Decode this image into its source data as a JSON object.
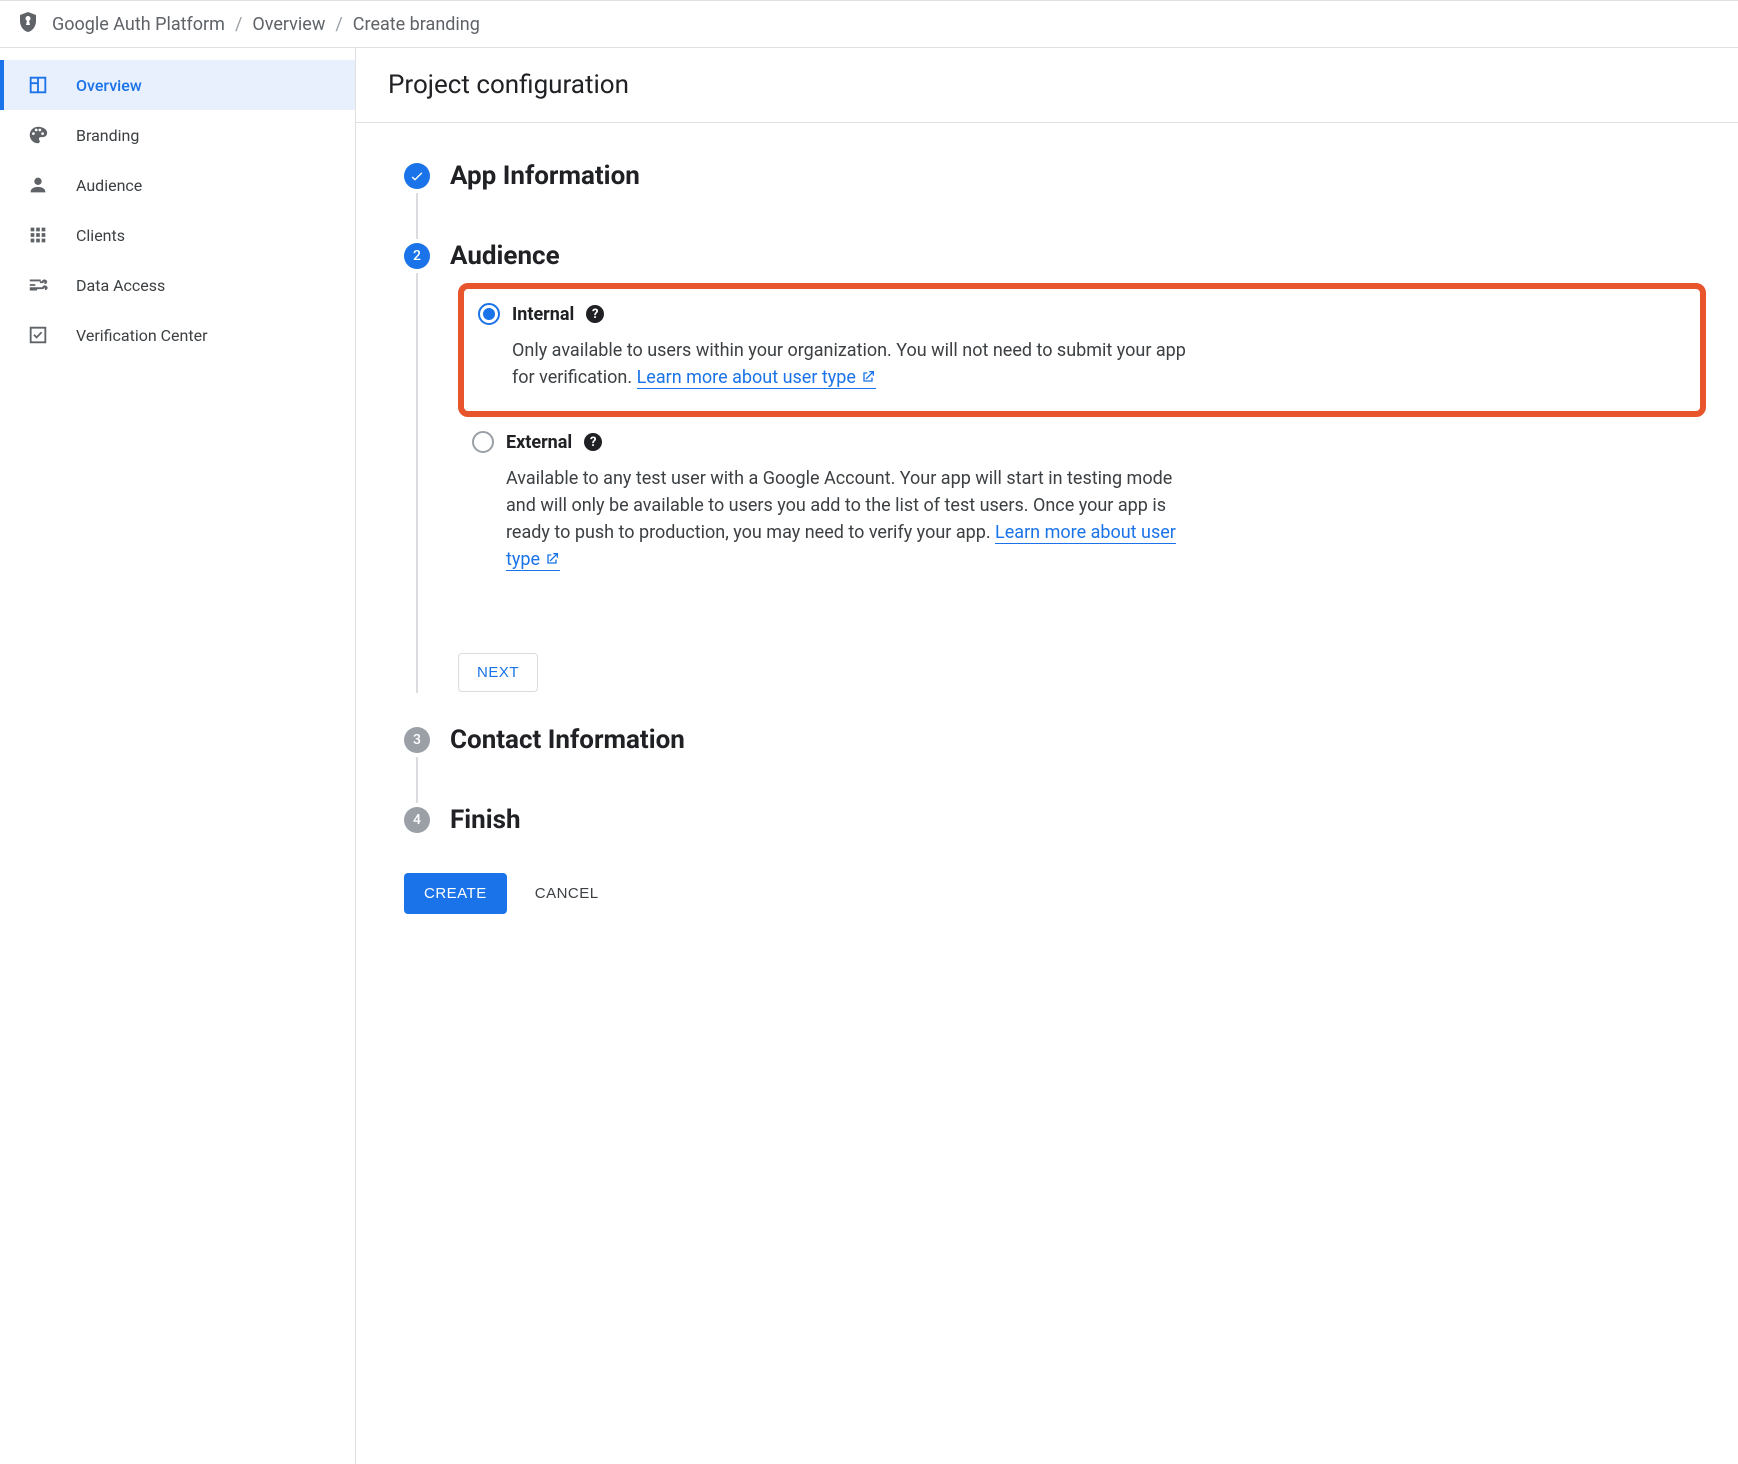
{
  "breadcrumb": {
    "product": "Google Auth Platform",
    "section": "Overview",
    "page": "Create branding"
  },
  "sidebar": {
    "items": [
      {
        "label": "Overview"
      },
      {
        "label": "Branding"
      },
      {
        "label": "Audience"
      },
      {
        "label": "Clients"
      },
      {
        "label": "Data Access"
      },
      {
        "label": "Verification Center"
      }
    ]
  },
  "page_title": "Project configuration",
  "steps": {
    "app_info": {
      "title": "App Information"
    },
    "audience": {
      "number": "2",
      "title": "Audience",
      "options": {
        "internal": {
          "label": "Internal",
          "desc": "Only available to users within your organization. You will not need to submit your app for verification. ",
          "link": "Learn more about user type"
        },
        "external": {
          "label": "External",
          "desc": "Available to any test user with a Google Account. Your app will start in testing mode and will only be available to users you add to the list of test users. Once your app is ready to push to production, you may need to verify your app. ",
          "link": "Learn more about user type"
        }
      },
      "next": "NEXT"
    },
    "contact": {
      "number": "3",
      "title": "Contact Information"
    },
    "finish": {
      "number": "4",
      "title": "Finish"
    }
  },
  "actions": {
    "create": "CREATE",
    "cancel": "CANCEL"
  }
}
